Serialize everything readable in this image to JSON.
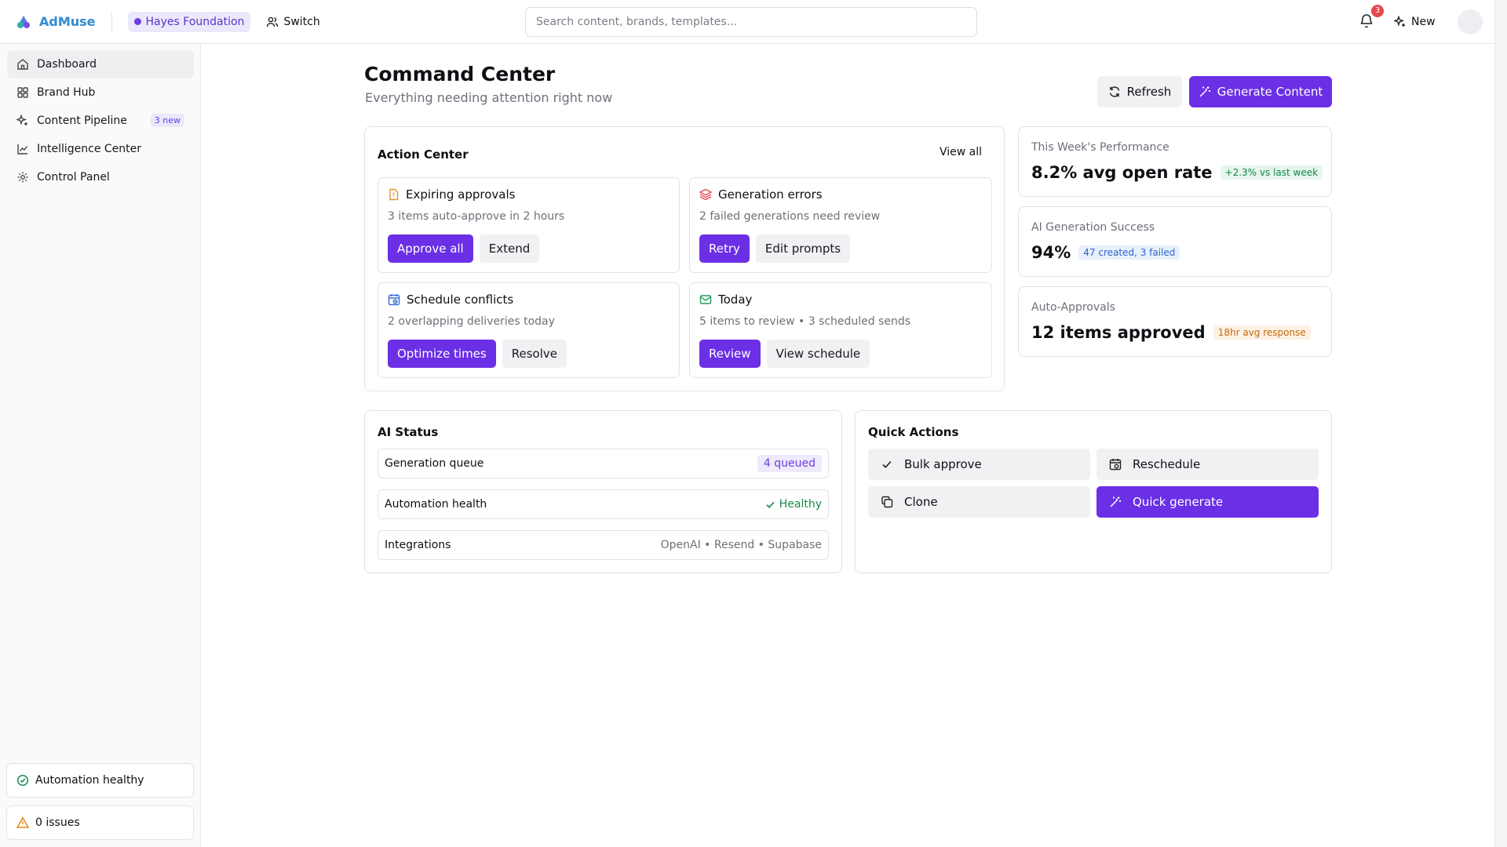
{
  "app": {
    "name": "AdMuse"
  },
  "header": {
    "org_name": "Hayes Foundation",
    "switch_label": "Switch",
    "search_placeholder": "Search content, brands, templates...",
    "notification_count": "3",
    "new_label": "New"
  },
  "sidebar": {
    "items": [
      {
        "label": "Dashboard",
        "icon": "home-icon",
        "active": true
      },
      {
        "label": "Brand Hub",
        "icon": "grid-icon"
      },
      {
        "label": "Content Pipeline",
        "icon": "sparkles-icon",
        "badge": "3 new"
      },
      {
        "label": "Intelligence Center",
        "icon": "chart-line-icon"
      },
      {
        "label": "Control Panel",
        "icon": "gear-icon"
      }
    ],
    "automation_status": "Automation healthy",
    "issues": "0 issues"
  },
  "page": {
    "title": "Command Center",
    "subtitle": "Everything needing attention right now",
    "refresh_label": "Refresh",
    "generate_label": "Generate Content"
  },
  "action_center": {
    "title": "Action Center",
    "view_all": "View all",
    "tasks": [
      {
        "title": "Expiring approvals",
        "desc": "3 items auto-approve in 2 hours",
        "primary": "Approve all",
        "secondary": "Extend",
        "icon_color": "#e8912a"
      },
      {
        "title": "Generation errors",
        "desc": "2 failed generations need review",
        "primary": "Retry",
        "secondary": "Edit prompts",
        "icon_color": "#e5484d"
      },
      {
        "title": "Schedule conflicts",
        "desc": "2 overlapping deliveries today",
        "primary": "Optimize times",
        "secondary": "Resolve",
        "icon_color": "#3b6fd4"
      },
      {
        "title": "Today",
        "desc": "5 items to review • 3 scheduled sends",
        "primary": "Review",
        "secondary": "View schedule",
        "icon_color": "#1f9d5c"
      }
    ]
  },
  "metrics": [
    {
      "label": "This Week's Performance",
      "value": "8.2% avg open rate",
      "pill": "+2.3% vs last week"
    },
    {
      "label": "AI Generation Success",
      "value": "94%",
      "pill": "47 created, 3 failed"
    },
    {
      "label": "Auto-Approvals",
      "value": "12 items approved",
      "pill": "18hr avg response"
    }
  ],
  "ai_status": {
    "title": "AI Status",
    "rows": [
      {
        "label": "Generation queue",
        "value": "4 queued"
      },
      {
        "label": "Automation health",
        "value": "Healthy"
      },
      {
        "label": "Integrations",
        "value": "OpenAI • Resend • Supabase"
      }
    ]
  },
  "quick_actions": {
    "title": "Quick Actions",
    "items": [
      {
        "label": "Bulk approve",
        "icon": "check-icon"
      },
      {
        "label": "Reschedule",
        "icon": "calendar-icon"
      },
      {
        "label": "Clone",
        "icon": "copy-icon"
      },
      {
        "label": "Quick generate",
        "icon": "magic-wand-icon"
      }
    ]
  },
  "colors": {
    "accent": "#6b2fe6",
    "success": "#168a4e",
    "danger": "#e5484d"
  }
}
